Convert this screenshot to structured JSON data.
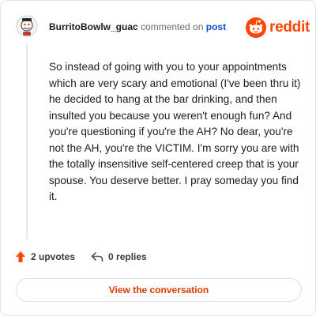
{
  "header": {
    "username": "BurritoBowlw_guac",
    "action_text": "commented on",
    "post_link": "post",
    "brand_name": "reddit",
    "brand_color": "#ff4500"
  },
  "comment": {
    "body": "So instead of going with you to your appointments which are very scary and emotional (I've been thru it) he decided to hang at the bar drinking, and then insulted you because you weren't enough fun? And you're questioning if you're the AH? No dear, you're not the AH, you're the VICTIM. I'm sorry you are with the totally insensitive self-centered creep that is your spouse. You deserve better. I pray someday you find it."
  },
  "stats": {
    "upvotes": "2 upvotes",
    "replies": "0 replies",
    "upvote_icon": "upvote-arrow-icon",
    "reply_icon": "reply-arrow-icon"
  },
  "actions": {
    "view_conversation": "View the conversation"
  }
}
